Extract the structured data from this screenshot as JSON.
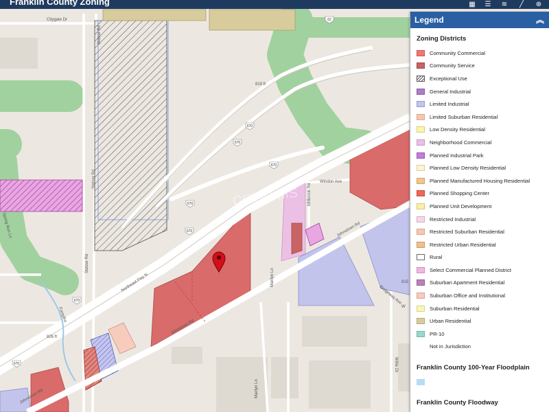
{
  "app": {
    "title": "Franklin County Zoning"
  },
  "toolbar": [
    "grid-icon",
    "list-icon",
    "layers-icon",
    "measure-icon",
    "globe-icon"
  ],
  "legend": {
    "title": "Legend",
    "zoning_title": "Zoning Districts",
    "zoning_items": [
      {
        "label": "Community Commercial",
        "fill": "#f07876",
        "border": "#d05050",
        "pattern": "solid"
      },
      {
        "label": "Community Service",
        "fill": "#c86464",
        "border": "#a04848",
        "pattern": "solid"
      },
      {
        "label": "Exceptional Use",
        "fill": "#ffffff",
        "border": "#555555",
        "pattern": "hatch"
      },
      {
        "label": "General Industrial",
        "fill": "#b07cc6",
        "border": "#8a5aa0",
        "pattern": "solid"
      },
      {
        "label": "Limited Industrial",
        "fill": "#c2c4ec",
        "border": "#9a9cd0",
        "pattern": "solid"
      },
      {
        "label": "Limited Suburban Residential",
        "fill": "#f6c7b0",
        "border": "#d8a890",
        "pattern": "solid"
      },
      {
        "label": "Low Density Residential",
        "fill": "#fbf6a8",
        "border": "#d8d080",
        "pattern": "solid"
      },
      {
        "label": "Neighborhood Commercial",
        "fill": "#ecbfe4",
        "border": "#c898c0",
        "pattern": "solid"
      },
      {
        "label": "Planned Industrial Park",
        "fill": "#c07ed8",
        "border": "#9a58b4",
        "pattern": "solid"
      },
      {
        "label": "Planned Low Density Residential",
        "fill": "#fcf4d4",
        "border": "#d8cca8",
        "pattern": "solid"
      },
      {
        "label": "Planned Manufactured Housing Residential",
        "fill": "#f2c68c",
        "border": "#d0a468",
        "pattern": "solid"
      },
      {
        "label": "Planned Shopping Center",
        "fill": "#f06658",
        "border": "#c84840",
        "pattern": "solid"
      },
      {
        "label": "Planned Unit Development",
        "fill": "#f8f0a4",
        "border": "#d4c880",
        "pattern": "solid"
      },
      {
        "label": "Restricted Industrial",
        "fill": "#f6d8e8",
        "border": "#d0b0c4",
        "pattern": "solid"
      },
      {
        "label": "Restricted Suburban Residential",
        "fill": "#f6c8b4",
        "border": "#d4a490",
        "pattern": "solid"
      },
      {
        "label": "Restricted Urban Residential",
        "fill": "#f0c08c",
        "border": "#cc9c68",
        "pattern": "solid"
      },
      {
        "label": "Rural",
        "fill": "#ffffff",
        "border": "#666666",
        "pattern": "solid"
      },
      {
        "label": "Select Commercial Planned District",
        "fill": "#f2b8e0",
        "border": "#cc90bc",
        "pattern": "solid"
      },
      {
        "label": "Suburban Apartment Residential",
        "fill": "#b884b4",
        "border": "#946090",
        "pattern": "solid"
      },
      {
        "label": "Suburban Office and Institutional",
        "fill": "#f8ccbc",
        "border": "#d4a898",
        "pattern": "solid"
      },
      {
        "label": "Suburban Residential",
        "fill": "#fcf6b4",
        "border": "#d8d090",
        "pattern": "solid"
      },
      {
        "label": "Urban Residential",
        "fill": "#d8cc9c",
        "border": "#b4a878",
        "pattern": "solid"
      },
      {
        "label": "PR-10",
        "fill": "#9ad8cc",
        "border": "#78b4a8",
        "pattern": "solid"
      },
      {
        "label": "Not in Jurisdiction",
        "fill": "#ffffff",
        "border": "#ffffff",
        "pattern": "none"
      }
    ],
    "floodplain_title": "Franklin County 100-Year Floodplain",
    "floodplain_fill": "#b6dcf6",
    "floodway_title": "Franklin County Floodway"
  },
  "map": {
    "road_labels": [
      {
        "name": "road-label-citygate-dr",
        "text": "Citygate Dr"
      },
      {
        "name": "road-label-stelzer-rd-north",
        "text": "Stelzer Rd"
      },
      {
        "name": "road-label-stelzer-rd-south",
        "text": "Stelzer Rd"
      },
      {
        "name": "road-label-northeast-fwy",
        "text": "Northeast Fwy N"
      },
      {
        "name": "road-label-johnstown-rd-east",
        "text": "Johnstown Rd"
      },
      {
        "name": "road-label-johnstown-rd-mid",
        "text": "Johnstown Rd"
      },
      {
        "name": "road-label-johnstown-rd-west",
        "text": "Johnstown Rd"
      },
      {
        "name": "road-label-windon-ave",
        "text": "Windon Ave"
      },
      {
        "name": "road-label-millbrook",
        "text": "Millbrook Rd"
      },
      {
        "name": "road-label-marilyn-ln-north",
        "text": "Marilyn Ln"
      },
      {
        "name": "road-label-marilyn-ln-south",
        "text": "Marilyn Ln"
      },
      {
        "name": "road-label-bridgeway-ave",
        "text": "Bridgeway Ave"
      },
      {
        "name": "road-label-willie-dr",
        "text": "Willie Dr"
      },
      {
        "name": "road-label-forsythe",
        "text": "Forsythe"
      },
      {
        "name": "road-label-stelzer-rd-2",
        "text": "Stelzer Rd"
      },
      {
        "name": "road-label-spring-run",
        "text": "Spring Run Ln"
      },
      {
        "name": "road-label-w",
        "text": "W"
      }
    ],
    "elevation_labels": [
      "819 ft",
      "826 ft",
      "815 ft"
    ],
    "highway_shields": [
      "670",
      "670",
      "670",
      "670",
      "670",
      "670",
      "670",
      "62"
    ],
    "watermark": "COOR MS"
  }
}
